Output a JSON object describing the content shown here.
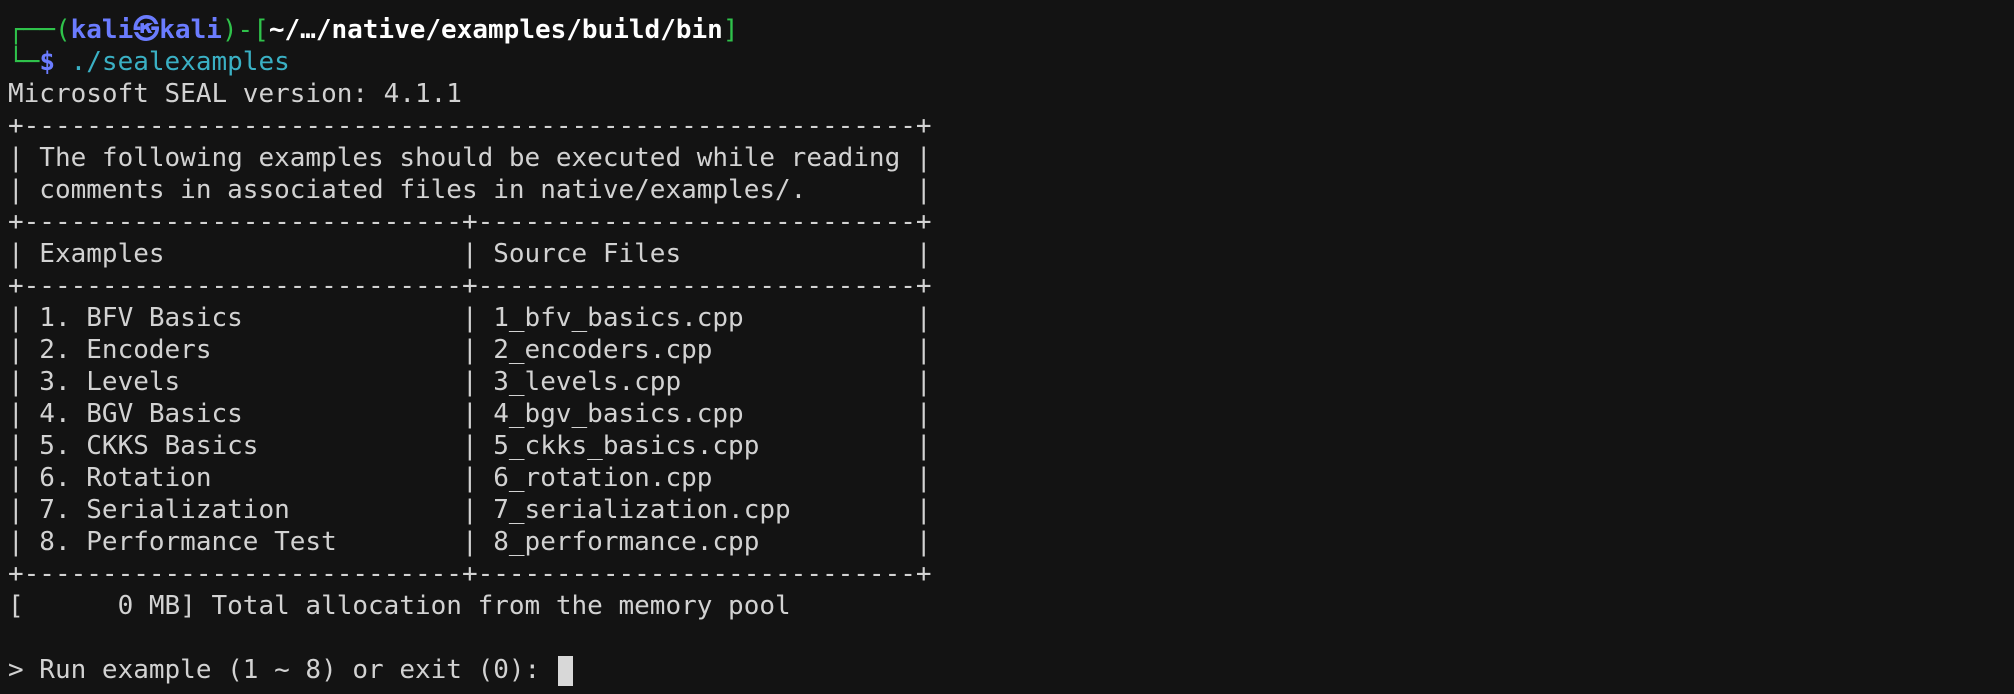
{
  "prompt": {
    "corner_top": "┌──(",
    "user": "kali",
    "skull": "㉿",
    "host": "kali",
    "sep": ")-[",
    "path": "~/…/native/examples/build/bin",
    "close": "]",
    "corner_bottom": "└─",
    "dollar": "$",
    "command": "./sealexamples"
  },
  "output": {
    "version_line": "Microsoft SEAL version: 4.1.1",
    "border_full": "+---------------------------------------------------------+",
    "intro_1": "| The following examples should be executed while reading |",
    "intro_2": "| comments in associated files in native/examples/.       |",
    "border_split": "+----------------------------+----------------------------+",
    "header_row": "| Examples                   | Source Files               |",
    "rows": [
      "| 1. BFV Basics              | 1_bfv_basics.cpp           |",
      "| 2. Encoders                | 2_encoders.cpp             |",
      "| 3. Levels                  | 3_levels.cpp               |",
      "| 4. BGV Basics              | 4_bgv_basics.cpp           |",
      "| 5. CKKS Basics             | 5_ckks_basics.cpp          |",
      "| 6. Rotation                | 6_rotation.cpp             |",
      "| 7. Serialization           | 7_serialization.cpp        |",
      "| 8. Performance Test        | 8_performance.cpp          |"
    ],
    "memory_line": "[      0 MB] Total allocation from the memory pool",
    "input_prompt": "> Run example (1 ~ 8) or exit (0): "
  },
  "colors": {
    "background": "#131313",
    "text": "#d2d2d2",
    "prompt_green": "#2fc24b",
    "user_blue": "#6b7cff",
    "command_cyan": "#3ab0c4"
  }
}
